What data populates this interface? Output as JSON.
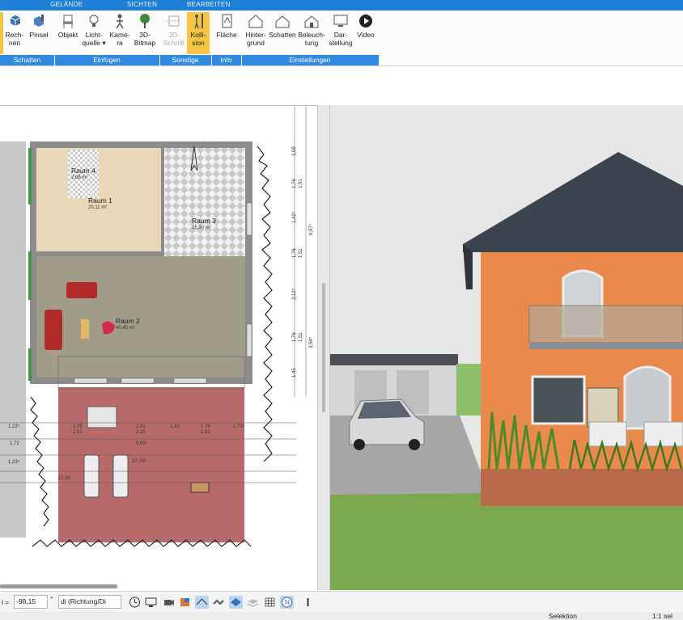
{
  "ribbon": {
    "context_tabs": [
      "GELÄNDE",
      "SICHTEN",
      "BEARBEITEN"
    ],
    "buttons": [
      {
        "label1": "Rech-",
        "label2": "nen"
      },
      {
        "label1": "Pinsel",
        "label2": ""
      },
      {
        "label1": "Objekt",
        "label2": ""
      },
      {
        "label1": "Licht-",
        "label2": "quelle ▾"
      },
      {
        "label1": "Kame-",
        "label2": "ra"
      },
      {
        "label1": "3D-",
        "label2": "Bitmap"
      },
      {
        "label1": "3D-",
        "label2": "Schnitt"
      },
      {
        "label1": "Kolli-",
        "label2": "sion"
      },
      {
        "label1": "Fläche",
        "label2": ""
      },
      {
        "label1": "Hinter-",
        "label2": "grund"
      },
      {
        "label1": "Schatten",
        "label2": ""
      },
      {
        "label1": "Beleuch-",
        "label2": "tung"
      },
      {
        "label1": "Dar-",
        "label2": "stellung"
      },
      {
        "label1": "Video",
        "label2": ""
      }
    ],
    "groups": [
      "Schatten",
      "Einfügen",
      "Sonstige",
      "Info",
      "Einstellungen"
    ]
  },
  "plan": {
    "rooms": [
      {
        "name": "Raum 4",
        "area": "2,88 m²"
      },
      {
        "name": "Raum 1",
        "area": "20,11 m²"
      },
      {
        "name": "Raum 3",
        "area": "25,90 m²"
      },
      {
        "name": "Raum 2",
        "area": "40,45 m²"
      }
    ],
    "dims_horizontal": [
      "1,23⁵",
      "1,76",
      "1,51",
      "2,02",
      "2,20",
      "1,10",
      "1,76",
      "1,51",
      "1,72",
      "1,23⁵",
      "9,65⁵",
      "10,76⁵",
      "17,60",
      "1,72⁵"
    ],
    "dims_vertical": [
      "1,09",
      "1,76",
      "1,51",
      "1,42⁵",
      "6,97⁵",
      "1,76",
      "1,51",
      "2,12⁵",
      "1,76",
      "1,51",
      "3,54⁵",
      "1,45"
    ]
  },
  "toolbar": {
    "input_prefix": "l =",
    "angle_value": "-98,15",
    "degree": "°",
    "direction_value": "dl (Richtung/Di"
  },
  "status": {
    "mode": "Selektion",
    "scale": "1:1 sel"
  },
  "colors": {
    "ribbon_blue": "#1e7fd6",
    "group_blue": "#2f8ae0",
    "active_button": "#f5c542"
  }
}
